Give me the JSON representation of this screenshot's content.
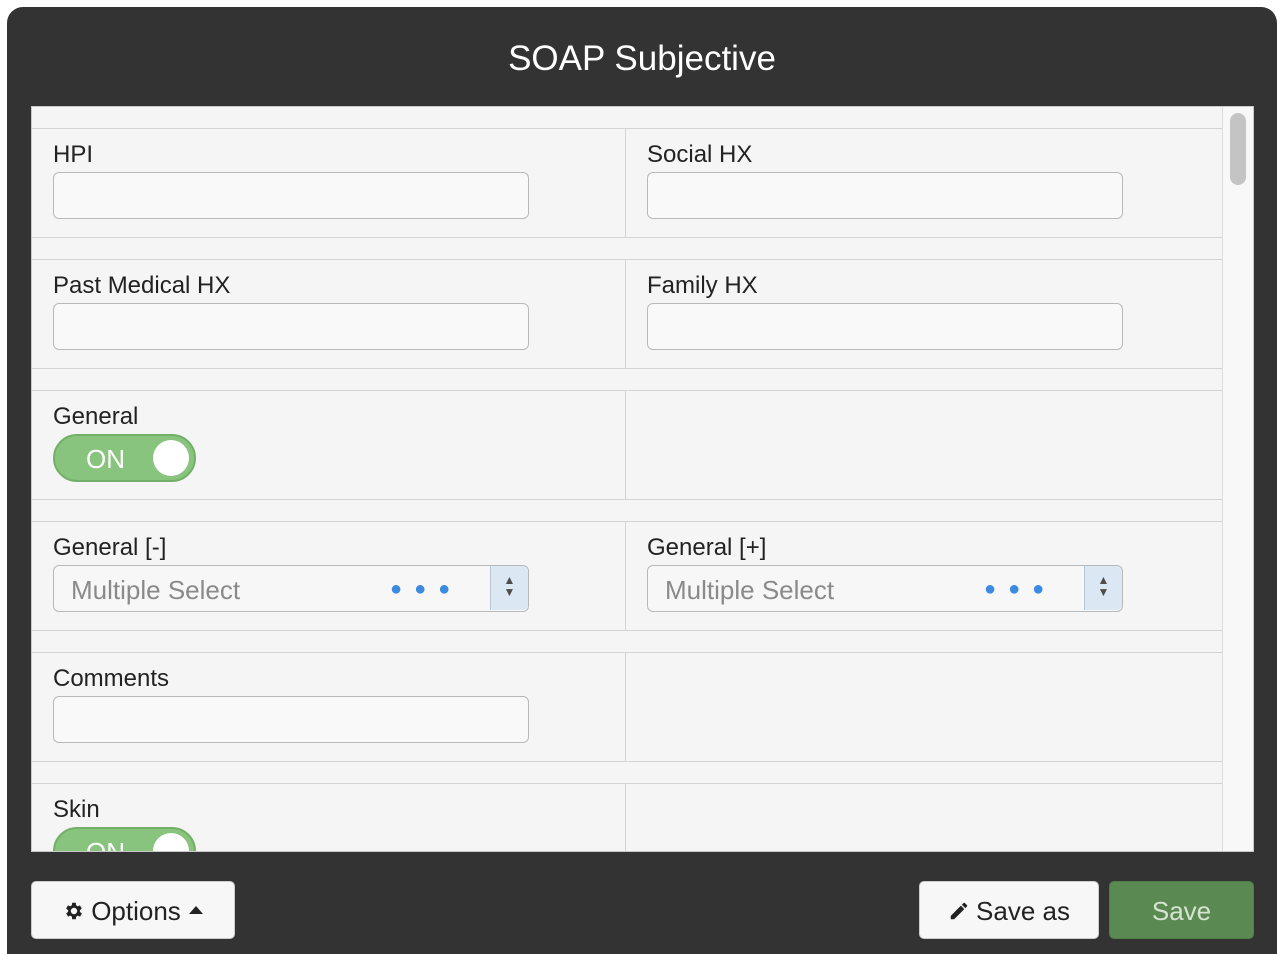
{
  "dialog": {
    "title": "SOAP Subjective"
  },
  "form": {
    "hpi": {
      "label": "HPI",
      "value": ""
    },
    "social_hx": {
      "label": "Social HX",
      "value": ""
    },
    "past_medical_hx": {
      "label": "Past Medical HX",
      "value": ""
    },
    "family_hx": {
      "label": "Family HX",
      "value": ""
    },
    "general": {
      "label": "General",
      "toggle_text": "ON"
    },
    "general_neg": {
      "label": "General [-]",
      "placeholder": "Multiple Select"
    },
    "general_pos": {
      "label": "General [+]",
      "placeholder": "Multiple Select"
    },
    "comments": {
      "label": "Comments",
      "value": ""
    },
    "skin": {
      "label": "Skin",
      "toggle_text": "ON"
    }
  },
  "footer": {
    "options_label": "Options",
    "save_as_label": "Save as",
    "save_label": "Save"
  },
  "colors": {
    "dialog_bg": "#333333",
    "toggle_on": "#88c47d",
    "save_button": "#5a8a51",
    "select_dots": "#3d8be0"
  },
  "icons": {
    "options": "gear-icon",
    "options_caret": "caret-up-icon",
    "save_as": "pencil-icon",
    "stepper": "updown-arrows-icon",
    "more": "ellipsis-icon"
  }
}
